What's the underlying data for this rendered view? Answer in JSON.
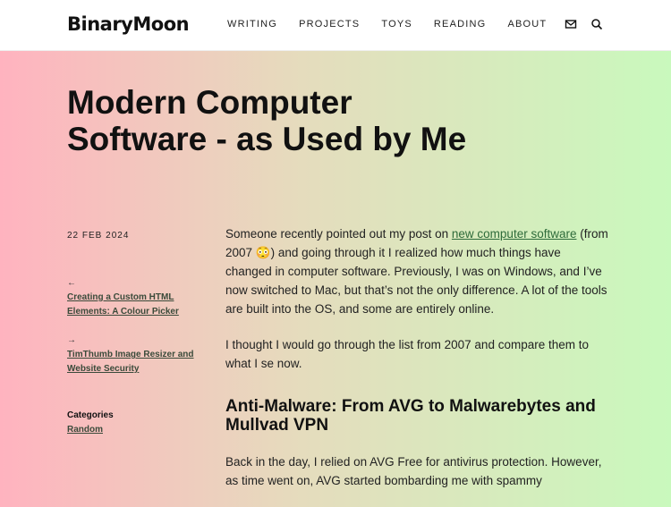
{
  "site": {
    "logo": "BinaryMoon"
  },
  "nav": {
    "items": [
      "WRITING",
      "PROJECTS",
      "TOYS",
      "READING",
      "ABOUT"
    ]
  },
  "icons": {
    "mail": "mail-icon",
    "search": "search-icon"
  },
  "post": {
    "title_line1": "Modern Computer",
    "title_line2": "Software - as Used by Me",
    "date": "22 FEB 2024",
    "prev": {
      "arrow": "←",
      "label": "Creating a Custom HTML Elements: A Colour Picker"
    },
    "next": {
      "arrow": "→",
      "label": "TimThumb Image Resizer and Website Security"
    },
    "categories": {
      "label": "Categories",
      "item": "Random"
    },
    "p1_before": "Someone recently pointed out my post on ",
    "p1_link": "new computer software",
    "p1_after": " (from 2007 😳) and going through it I realized how much things have changed in computer software. Previously, I was on Windows, and I’ve now switched to Mac, but that’s not the only difference. A lot of the tools are built into the OS, and some are entirely online.",
    "p2": "I thought I would go through the list from 2007 and compare them to what I se now.",
    "h2": "Anti-Malware: From AVG to Malwarebytes and Mullvad VPN",
    "p3": "Back in the day, I relied on AVG Free for antivirus protection. However, as time went on, AVG started bombarding me with spammy"
  },
  "colors": {
    "gradient_left": "#ffb3bf",
    "gradient_mid": "#e5dcbd",
    "gradient_right": "#c9f9bd",
    "link": "#2e6b3a"
  }
}
